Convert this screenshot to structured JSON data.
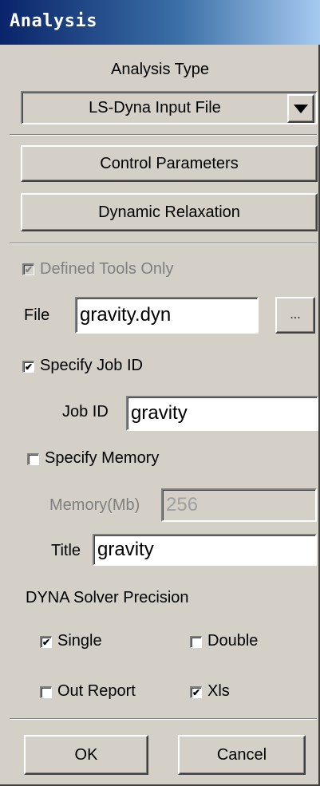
{
  "window": {
    "title": "Analysis"
  },
  "analysis_type": {
    "heading": "Analysis Type",
    "selected": "LS-Dyna Input File"
  },
  "buttons": {
    "control_parameters": "Control Parameters",
    "dynamic_relaxation": "Dynamic Relaxation",
    "browse": "...",
    "ok": "OK",
    "cancel": "Cancel"
  },
  "options": {
    "defined_tools_only": {
      "label": "Defined Tools  Only",
      "checked": true,
      "enabled": false
    },
    "specify_job_id": {
      "label": "Specify Job ID",
      "checked": true
    },
    "specify_memory": {
      "label": "Specify Memory",
      "checked": false
    }
  },
  "file": {
    "label": "File",
    "value": "gravity.dyn"
  },
  "job_id": {
    "label": "Job ID",
    "value": "gravity"
  },
  "memory": {
    "label": "Memory(Mb)",
    "value": "256",
    "enabled": false
  },
  "title_field": {
    "label": "Title",
    "value": "gravity"
  },
  "precision": {
    "heading": "DYNA Solver Precision",
    "single": {
      "label": "Single",
      "checked": true
    },
    "double": {
      "label": "Double",
      "checked": false
    },
    "out_report": {
      "label": "Out Report",
      "checked": false
    },
    "xls": {
      "label": "Xls",
      "checked": true
    }
  },
  "colors": {
    "face": "#d4d0c8",
    "title_gradient_start": "#0a246a",
    "title_gradient_end": "#a6caf0",
    "disabled_text": "#808080"
  }
}
